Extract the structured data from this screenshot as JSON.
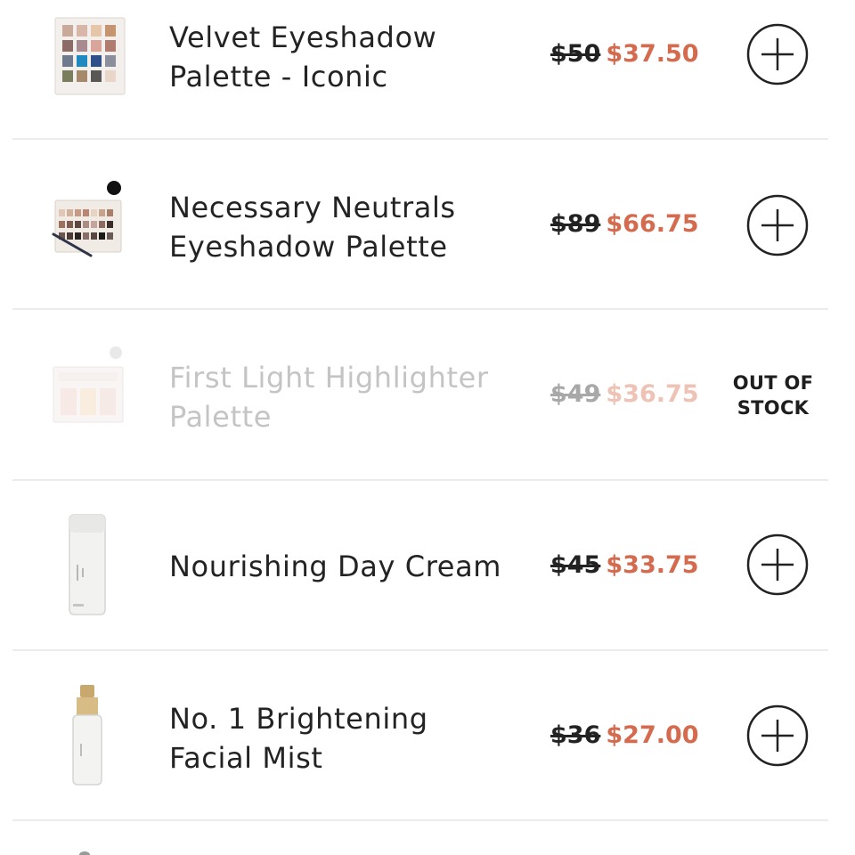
{
  "products": [
    {
      "name_line1": "Velvet Eyeshadow",
      "name_line2": "Palette - Iconic",
      "old_price": "$50",
      "new_price": "$37.50",
      "action_icon": "plus-circle-icon",
      "available": true
    },
    {
      "name_line1": "Necessary Neutrals",
      "name_line2": "Eyeshadow Palette",
      "old_price": "$89",
      "new_price": "$66.75",
      "action_icon": "plus-circle-icon",
      "available": true
    },
    {
      "name_line1": "First Light Highlighter",
      "name_line2": "Palette",
      "old_price": "$49",
      "new_price": "$36.75",
      "stock_line1": "OUT OF",
      "stock_line2": "STOCK",
      "available": false
    },
    {
      "name_line1": "Nourishing Day Cream",
      "old_price": "$45",
      "new_price": "$33.75",
      "action_icon": "plus-circle-icon",
      "available": true
    },
    {
      "name_line1": "No. 1 Brightening",
      "name_line2": "Facial Mist",
      "old_price": "$36",
      "new_price": "$27.00",
      "action_icon": "plus-circle-icon",
      "available": true
    }
  ],
  "colors": {
    "sale_price": "#d46a4e",
    "text": "#232323",
    "divider": "#ececec",
    "disabled_text": "#c4c4c4"
  }
}
